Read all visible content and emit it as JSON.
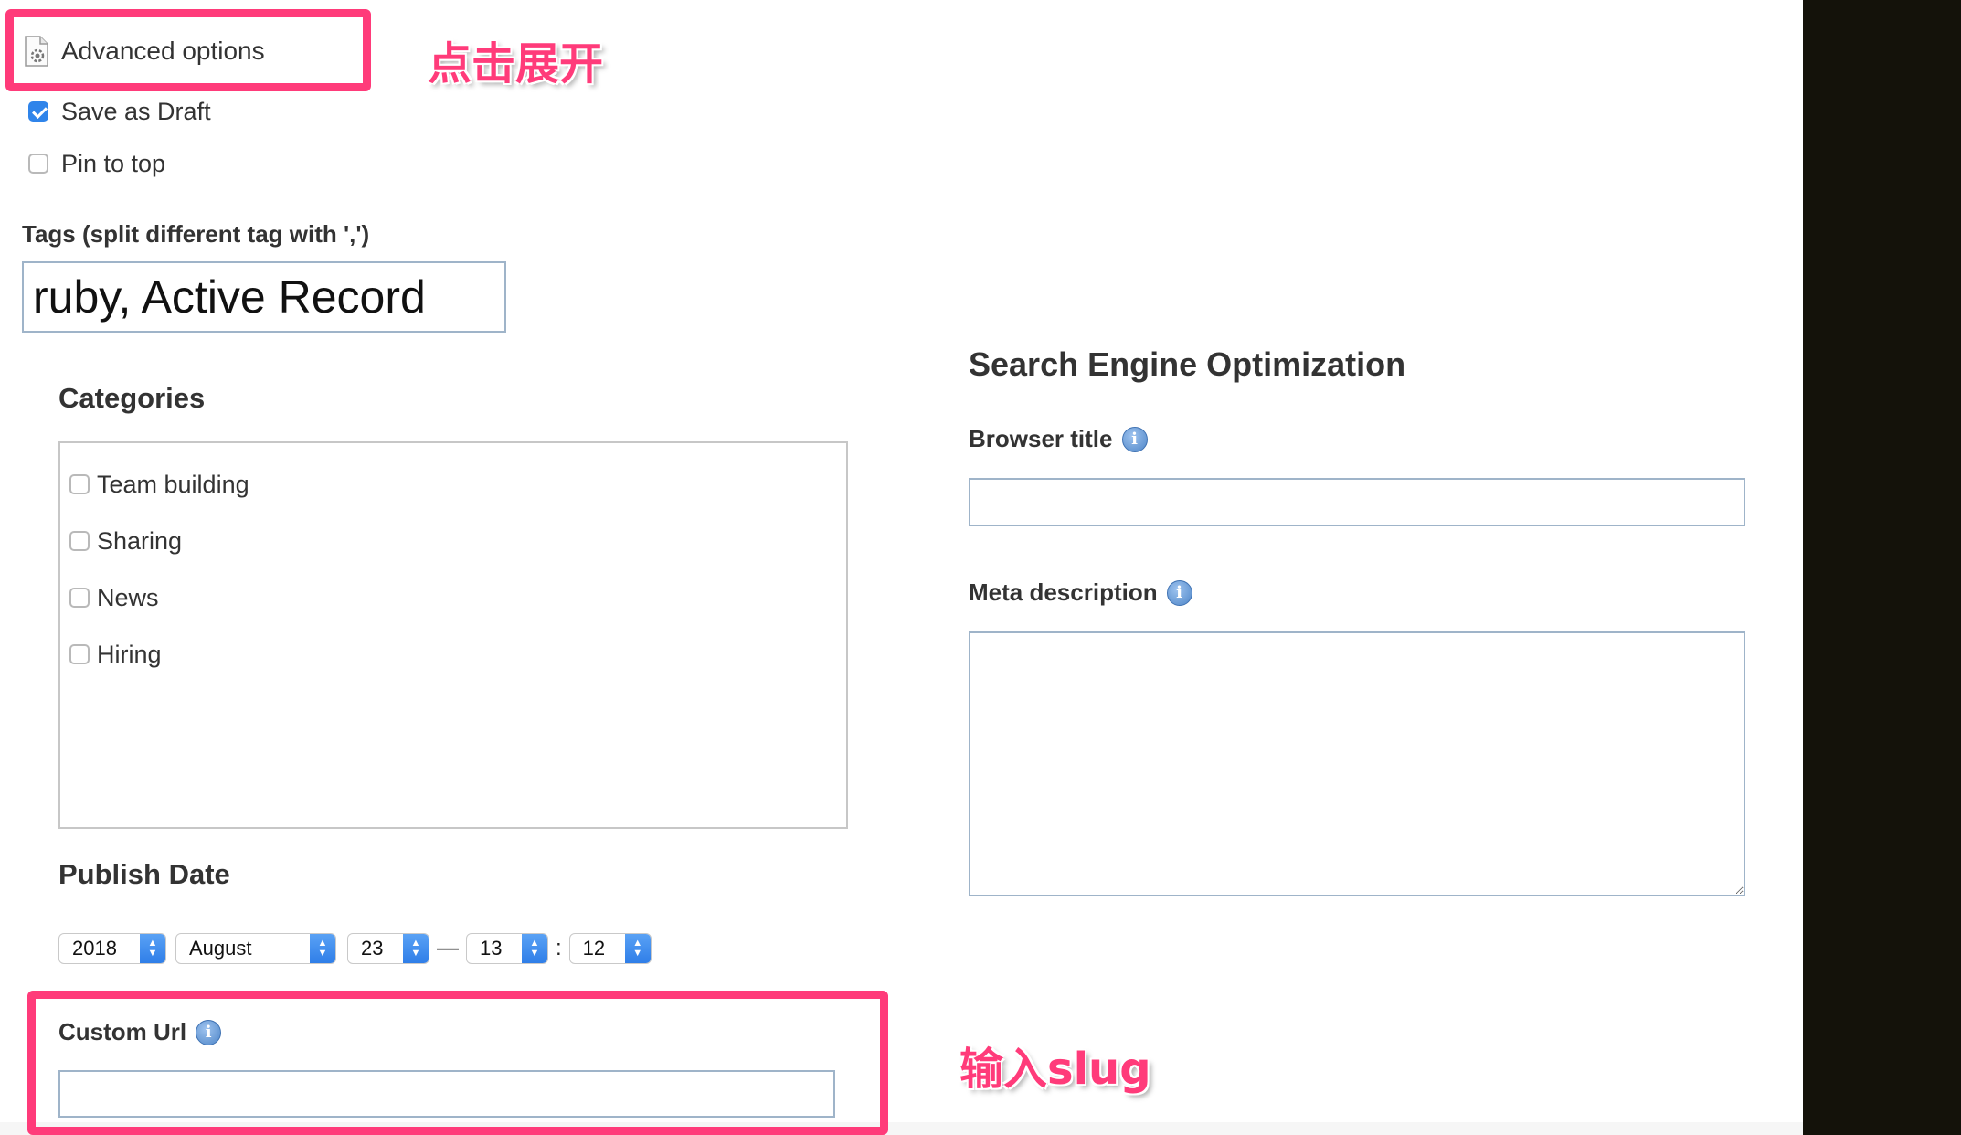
{
  "advanced": {
    "label": "Advanced options",
    "icon": "document-gear-icon"
  },
  "options": {
    "save_as_draft": {
      "label": "Save as Draft",
      "checked": true
    },
    "pin_to_top": {
      "label": "Pin to top",
      "checked": false
    }
  },
  "tags": {
    "label": "Tags (split different tag with ',')",
    "value": "ruby, Active Record"
  },
  "categories": {
    "title": "Categories",
    "items": [
      {
        "label": "Team building",
        "checked": false
      },
      {
        "label": "Sharing",
        "checked": false
      },
      {
        "label": "News",
        "checked": false
      },
      {
        "label": "Hiring",
        "checked": false
      }
    ]
  },
  "publish_date": {
    "title": "Publish Date",
    "year": "2018",
    "month": "August",
    "day": "23",
    "dash": "—",
    "hour": "13",
    "colon": ":",
    "minute": "12"
  },
  "custom_url": {
    "label": "Custom Url",
    "value": ""
  },
  "seo": {
    "title": "Search Engine Optimization",
    "browser_title_label": "Browser title",
    "browser_title_value": "",
    "meta_description_label": "Meta description",
    "meta_description_value": ""
  },
  "annotations": {
    "expand_hint": "点击展开",
    "slug_hint": "输入slug",
    "color": "#ff3b7a"
  },
  "colors": {
    "checkbox_accent": "#2f84ea",
    "select_accent": "#3f8cf0",
    "input_border": "#9fb4c9"
  }
}
